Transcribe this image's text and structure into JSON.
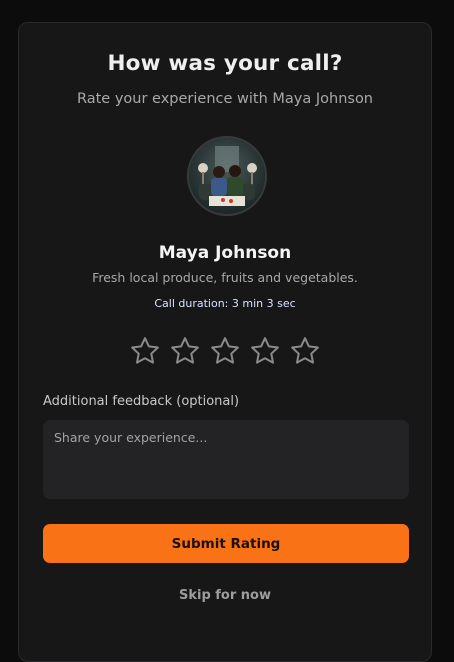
{
  "dialog": {
    "title": "How was your call?",
    "subtitle": "Rate your experience with Maya Johnson"
  },
  "contact": {
    "name": "Maya Johnson",
    "description": "Fresh local produce, fruits and vegetables.",
    "call_duration": "Call duration: 3 min 3 sec",
    "avatar_icon": "avatar-photo"
  },
  "rating": {
    "max_stars": 5,
    "selected": 0,
    "star_icon": "star-outline-icon"
  },
  "feedback": {
    "label": "Additional feedback (optional)",
    "placeholder": "Share your experience...",
    "value": ""
  },
  "actions": {
    "submit_label": "Submit Rating",
    "skip_label": "Skip for now"
  },
  "colors": {
    "accent": "#f97316",
    "background": "#171717",
    "star_stroke": "#8a8a8d"
  }
}
